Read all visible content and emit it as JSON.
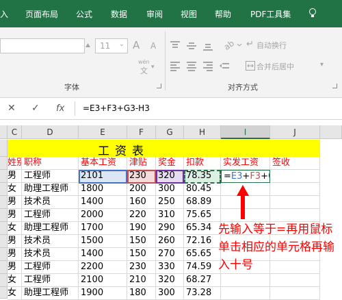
{
  "ribbon_tabs": [
    "入",
    "页面布局",
    "公式",
    "数据",
    "审阅",
    "视图",
    "帮助",
    "PDF工具集"
  ],
  "ribbon": {
    "font_size": "11",
    "grow_font": "A",
    "shrink_font": "A",
    "phonetic_top": "wén",
    "phonetic_bottom": "文",
    "wrap_text": "自动换行",
    "merge_center": "合并后居中",
    "font_group": "字体",
    "alignment_group": "对齐方式"
  },
  "formula_bar": {
    "cancel_icon": "✕",
    "enter_icon": "✓",
    "fx": "fx",
    "formula": "=E3+F3+G3-H3"
  },
  "columns": [
    "C",
    "D",
    "E",
    "F",
    "G",
    "H",
    "I",
    "J"
  ],
  "title": "工资表",
  "headers": {
    "c": "姓别",
    "d": "职称",
    "e": "基本工资",
    "f": "津贴",
    "g": "奖金",
    "h": "扣款",
    "i": "实发工资",
    "j": "签收"
  },
  "rows": [
    {
      "c": "男",
      "d": "工程师",
      "e": "2101",
      "f": "230",
      "g": "320",
      "h": "78.35"
    },
    {
      "c": "女",
      "d": "助理工程师",
      "e": "1800",
      "f": "200",
      "g": "300",
      "h": "80.45"
    },
    {
      "c": "男",
      "d": "技术员",
      "e": "1400",
      "f": "160",
      "g": "250",
      "h": "68.89"
    },
    {
      "c": "男",
      "d": "工程师",
      "e": "2000",
      "f": "220",
      "g": "310",
      "h": "75.65"
    },
    {
      "c": "女",
      "d": "助理工程师",
      "e": "1700",
      "f": "190",
      "g": "290",
      "h": "65.34"
    },
    {
      "c": "男",
      "d": "技术员",
      "e": "1500",
      "f": "150",
      "g": "260",
      "h": "72.16"
    },
    {
      "c": "男",
      "d": "技术员",
      "e": "1400",
      "f": "150",
      "g": "270",
      "h": "65.65"
    },
    {
      "c": "男",
      "d": "工程师",
      "e": "2200",
      "f": "230",
      "g": "330",
      "h": "74.59"
    },
    {
      "c": "女",
      "d": "工程师",
      "e": "2100",
      "f": "210",
      "g": "320",
      "h": "68.27"
    },
    {
      "c": "女",
      "d": "助理工程师",
      "e": "1900",
      "f": "180",
      "g": "300",
      "h": "73.28"
    }
  ],
  "edit_formula": {
    "eq": "=",
    "e3": "E3",
    "plus1": "+",
    "f3": "F3",
    "plus2": "+",
    "g3": "G3",
    "minus": "-",
    "h3": "H3"
  },
  "annotation": "先输入等于=再用鼠标单击相应的单元格再输入十号",
  "colors": {
    "excel_green": "#217346",
    "title_fill": "#ffff00",
    "header_text": "#ff0000",
    "ref_e3": "#4472c4",
    "ref_f3": "#c0504d",
    "ref_g3": "#7030a0",
    "ref_h3": "#217346"
  },
  "icons": [
    "lightbulb-icon",
    "up-arrow-icon",
    "grow-font-icon",
    "shrink-font-icon",
    "align-top-icon",
    "align-middle-icon",
    "align-bottom-icon",
    "orientation-icon",
    "align-left-icon",
    "align-center-icon",
    "align-right-icon",
    "decrease-indent-icon",
    "increase-indent-icon",
    "wrap-text-icon",
    "merge-center-icon",
    "phonetic-guide-icon",
    "dialog-launcher-icon",
    "cancel-icon",
    "enter-icon",
    "function-icon"
  ]
}
